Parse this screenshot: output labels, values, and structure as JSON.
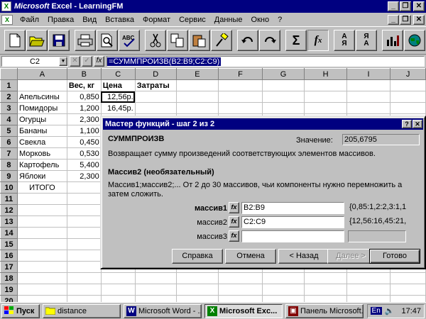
{
  "app": {
    "title_brand": "Microsoft",
    "title_rest": " Excel - LearningFM",
    "min": "_",
    "restore": "❐",
    "close": "✕"
  },
  "menu": [
    "Файл",
    "Правка",
    "Вид",
    "Вставка",
    "Формат",
    "Сервис",
    "Данные",
    "Окно",
    "?"
  ],
  "formula_bar": {
    "cell_ref": "C2",
    "cancel": "✕",
    "confirm": "✓",
    "fx": "fx",
    "formula": "=СУММПРОИЗВ(B2:B9;C2:C9)"
  },
  "sheet": {
    "columns": [
      "A",
      "B",
      "C",
      "D",
      "E",
      "F",
      "G",
      "H",
      "I",
      "J"
    ],
    "rows": [
      [
        "",
        "Вес, кг",
        "Цена",
        "Затраты",
        "",
        "",
        "",
        "",
        "",
        ""
      ],
      [
        "Апельсины",
        "0,850",
        "12,56р.",
        "",
        "",
        "",
        "",
        "",
        "",
        ""
      ],
      [
        "Помидоры",
        "1,200",
        "16,45р.",
        "",
        "",
        "",
        "",
        "",
        "",
        ""
      ],
      [
        "Огурцы",
        "2,300",
        "",
        "",
        "",
        "",
        "",
        "",
        "",
        ""
      ],
      [
        "Бананы",
        "1,100",
        "",
        "",
        "",
        "",
        "",
        "",
        "",
        ""
      ],
      [
        "Свекла",
        "0,450",
        "",
        "",
        "",
        "",
        "",
        "",
        "",
        ""
      ],
      [
        "Морковь",
        "0,530",
        "",
        "",
        "",
        "",
        "",
        "",
        "",
        ""
      ],
      [
        "Картофель",
        "5,400",
        "",
        "",
        "",
        "",
        "",
        "",
        "",
        ""
      ],
      [
        "Яблоки",
        "2,300",
        "",
        "",
        "",
        "",
        "",
        "",
        "",
        ""
      ],
      [
        "ИТОГО",
        "",
        "",
        "",
        "",
        "",
        "",
        "",
        "",
        ""
      ],
      [
        "",
        "",
        "",
        "",
        "",
        "",
        "",
        "",
        "",
        ""
      ],
      [
        "",
        "",
        "",
        "",
        "",
        "",
        "",
        "",
        "",
        ""
      ],
      [
        "",
        "",
        "",
        "",
        "",
        "",
        "",
        "",
        "",
        ""
      ],
      [
        "",
        "",
        "",
        "",
        "",
        "",
        "",
        "",
        "",
        ""
      ],
      [
        "",
        "",
        "",
        "",
        "",
        "",
        "",
        "",
        "",
        ""
      ],
      [
        "",
        "",
        "",
        "",
        "",
        "",
        "",
        "",
        "",
        ""
      ],
      [
        "",
        "",
        "",
        "",
        "",
        "",
        "",
        "",
        "",
        ""
      ],
      [
        "",
        "",
        "",
        "",
        "",
        "",
        "",
        "",
        "",
        ""
      ],
      [
        "",
        "",
        "",
        "",
        "",
        "",
        "",
        "",
        "",
        ""
      ],
      [
        "",
        "",
        "",
        "",
        "",
        "",
        "",
        "",
        "",
        ""
      ]
    ]
  },
  "dialog": {
    "title": "Мастер функций - шаг 2 из 2",
    "help": "?",
    "close": "✕",
    "function_name": "СУММПРОИЗВ",
    "value_label": "Значение:",
    "value": "205,6795",
    "description": "Возвращает сумму произведений соответствующих элементов массивов.",
    "arg_title": "Массив2 (необязательный)",
    "arg_description": "Массив1;массив2;... От 2 до 30 массивов, чьи компоненты нужно перемножить а затем сложить.",
    "fx_label": "fx",
    "args": [
      {
        "label": "массив1",
        "value": "B2:B9",
        "result": "{0,85:1,2:2,3:1,1:"
      },
      {
        "label": "массив2",
        "value": "C2:C9",
        "result": "{12,56:16,45:21,8"
      },
      {
        "label": "массив3",
        "value": "",
        "result": ""
      }
    ],
    "buttons": {
      "help": "Справка",
      "cancel": "Отмена",
      "back": "< Назад",
      "next": "Далее >",
      "finish": "Готово"
    }
  },
  "taskbar": {
    "start": "Пуск",
    "tasks": [
      "distance",
      "Microsoft Word - ...",
      "Microsoft Exc...",
      "Панель Microsoft..."
    ],
    "lang": "En",
    "clock": "17:47"
  }
}
